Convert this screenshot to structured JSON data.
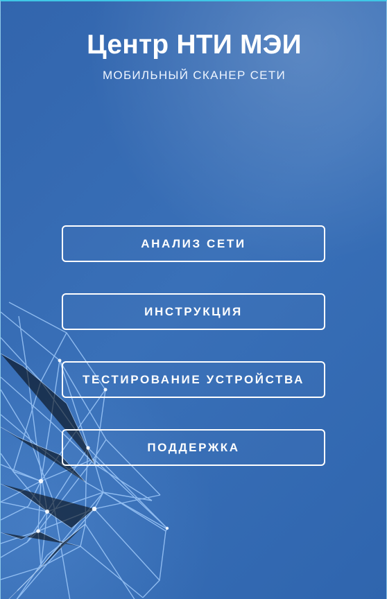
{
  "header": {
    "title": "Центр НТИ МЭИ",
    "subtitle": "МОБИЛЬНЫЙ СКАНЕР СЕТИ"
  },
  "menu": {
    "items": [
      {
        "label": "АНАЛИЗ СЕТИ"
      },
      {
        "label": "ИНСТРУКЦИЯ"
      },
      {
        "label": "ТЕСТИРОВАНИЕ УСТРОЙСТВА"
      },
      {
        "label": "ПОДДЕРЖКА"
      }
    ]
  },
  "colors": {
    "background": "#3268b1",
    "accent_top_border": "#3fc7e6",
    "button_border": "#ffffff",
    "text": "#ffffff",
    "network_lines": "#a7d0ff"
  }
}
